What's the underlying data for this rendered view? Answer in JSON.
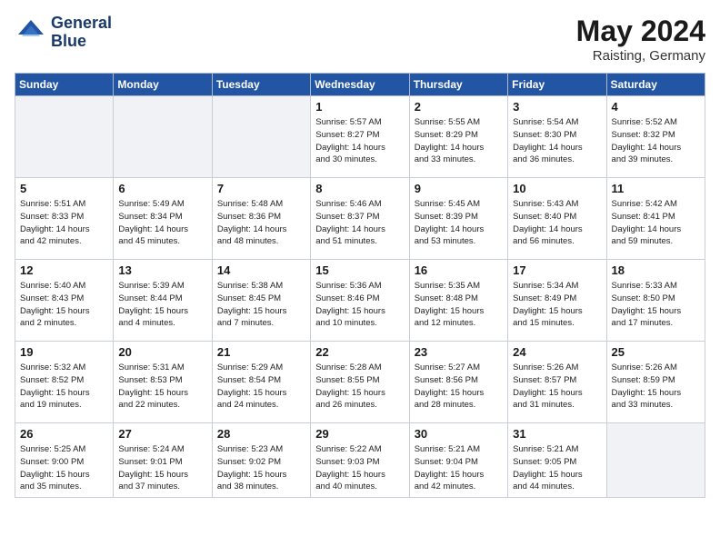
{
  "header": {
    "logo_line1": "General",
    "logo_line2": "Blue",
    "month": "May 2024",
    "location": "Raisting, Germany"
  },
  "weekdays": [
    "Sunday",
    "Monday",
    "Tuesday",
    "Wednesday",
    "Thursday",
    "Friday",
    "Saturday"
  ],
  "weeks": [
    [
      {
        "day": "",
        "info": ""
      },
      {
        "day": "",
        "info": ""
      },
      {
        "day": "",
        "info": ""
      },
      {
        "day": "1",
        "info": "Sunrise: 5:57 AM\nSunset: 8:27 PM\nDaylight: 14 hours\nand 30 minutes."
      },
      {
        "day": "2",
        "info": "Sunrise: 5:55 AM\nSunset: 8:29 PM\nDaylight: 14 hours\nand 33 minutes."
      },
      {
        "day": "3",
        "info": "Sunrise: 5:54 AM\nSunset: 8:30 PM\nDaylight: 14 hours\nand 36 minutes."
      },
      {
        "day": "4",
        "info": "Sunrise: 5:52 AM\nSunset: 8:32 PM\nDaylight: 14 hours\nand 39 minutes."
      }
    ],
    [
      {
        "day": "5",
        "info": "Sunrise: 5:51 AM\nSunset: 8:33 PM\nDaylight: 14 hours\nand 42 minutes."
      },
      {
        "day": "6",
        "info": "Sunrise: 5:49 AM\nSunset: 8:34 PM\nDaylight: 14 hours\nand 45 minutes."
      },
      {
        "day": "7",
        "info": "Sunrise: 5:48 AM\nSunset: 8:36 PM\nDaylight: 14 hours\nand 48 minutes."
      },
      {
        "day": "8",
        "info": "Sunrise: 5:46 AM\nSunset: 8:37 PM\nDaylight: 14 hours\nand 51 minutes."
      },
      {
        "day": "9",
        "info": "Sunrise: 5:45 AM\nSunset: 8:39 PM\nDaylight: 14 hours\nand 53 minutes."
      },
      {
        "day": "10",
        "info": "Sunrise: 5:43 AM\nSunset: 8:40 PM\nDaylight: 14 hours\nand 56 minutes."
      },
      {
        "day": "11",
        "info": "Sunrise: 5:42 AM\nSunset: 8:41 PM\nDaylight: 14 hours\nand 59 minutes."
      }
    ],
    [
      {
        "day": "12",
        "info": "Sunrise: 5:40 AM\nSunset: 8:43 PM\nDaylight: 15 hours\nand 2 minutes."
      },
      {
        "day": "13",
        "info": "Sunrise: 5:39 AM\nSunset: 8:44 PM\nDaylight: 15 hours\nand 4 minutes."
      },
      {
        "day": "14",
        "info": "Sunrise: 5:38 AM\nSunset: 8:45 PM\nDaylight: 15 hours\nand 7 minutes."
      },
      {
        "day": "15",
        "info": "Sunrise: 5:36 AM\nSunset: 8:46 PM\nDaylight: 15 hours\nand 10 minutes."
      },
      {
        "day": "16",
        "info": "Sunrise: 5:35 AM\nSunset: 8:48 PM\nDaylight: 15 hours\nand 12 minutes."
      },
      {
        "day": "17",
        "info": "Sunrise: 5:34 AM\nSunset: 8:49 PM\nDaylight: 15 hours\nand 15 minutes."
      },
      {
        "day": "18",
        "info": "Sunrise: 5:33 AM\nSunset: 8:50 PM\nDaylight: 15 hours\nand 17 minutes."
      }
    ],
    [
      {
        "day": "19",
        "info": "Sunrise: 5:32 AM\nSunset: 8:52 PM\nDaylight: 15 hours\nand 19 minutes."
      },
      {
        "day": "20",
        "info": "Sunrise: 5:31 AM\nSunset: 8:53 PM\nDaylight: 15 hours\nand 22 minutes."
      },
      {
        "day": "21",
        "info": "Sunrise: 5:29 AM\nSunset: 8:54 PM\nDaylight: 15 hours\nand 24 minutes."
      },
      {
        "day": "22",
        "info": "Sunrise: 5:28 AM\nSunset: 8:55 PM\nDaylight: 15 hours\nand 26 minutes."
      },
      {
        "day": "23",
        "info": "Sunrise: 5:27 AM\nSunset: 8:56 PM\nDaylight: 15 hours\nand 28 minutes."
      },
      {
        "day": "24",
        "info": "Sunrise: 5:26 AM\nSunset: 8:57 PM\nDaylight: 15 hours\nand 31 minutes."
      },
      {
        "day": "25",
        "info": "Sunrise: 5:26 AM\nSunset: 8:59 PM\nDaylight: 15 hours\nand 33 minutes."
      }
    ],
    [
      {
        "day": "26",
        "info": "Sunrise: 5:25 AM\nSunset: 9:00 PM\nDaylight: 15 hours\nand 35 minutes."
      },
      {
        "day": "27",
        "info": "Sunrise: 5:24 AM\nSunset: 9:01 PM\nDaylight: 15 hours\nand 37 minutes."
      },
      {
        "day": "28",
        "info": "Sunrise: 5:23 AM\nSunset: 9:02 PM\nDaylight: 15 hours\nand 38 minutes."
      },
      {
        "day": "29",
        "info": "Sunrise: 5:22 AM\nSunset: 9:03 PM\nDaylight: 15 hours\nand 40 minutes."
      },
      {
        "day": "30",
        "info": "Sunrise: 5:21 AM\nSunset: 9:04 PM\nDaylight: 15 hours\nand 42 minutes."
      },
      {
        "day": "31",
        "info": "Sunrise: 5:21 AM\nSunset: 9:05 PM\nDaylight: 15 hours\nand 44 minutes."
      },
      {
        "day": "",
        "info": ""
      }
    ]
  ]
}
